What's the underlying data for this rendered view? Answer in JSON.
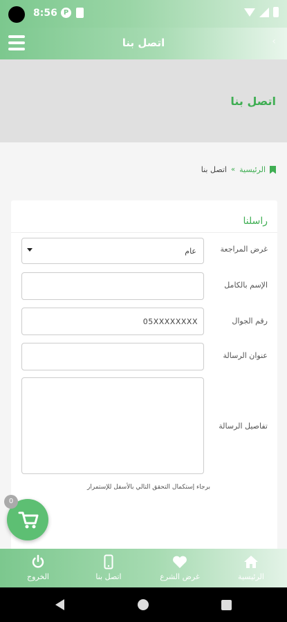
{
  "status_bar": {
    "time": "8:56"
  },
  "app_bar": {
    "title": "اتصل بنا",
    "back": "‹"
  },
  "banner": {
    "title": "اتصل بنا"
  },
  "breadcrumb": {
    "home": "الرئيسية",
    "separator": "»",
    "current": "اتصل بنا"
  },
  "form": {
    "heading": "راسلنا",
    "purpose_label": "غرض المراجعة",
    "purpose_value": "عام",
    "name_label": "الإسم بالكامل",
    "name_value": "",
    "mobile_label": "رقم الجوال",
    "mobile_value": "05XXXXXXXX",
    "subject_label": "عنوان الرسالة",
    "subject_value": "",
    "details_label": "تفاصيل الرسالة",
    "details_value": "",
    "captcha_note": "برجاء إستكمال التحقق التالي بالأسفل للإستمرار"
  },
  "cart": {
    "count": "0"
  },
  "bottom_nav": {
    "items": [
      {
        "label": "الخروج",
        "icon": "power-icon"
      },
      {
        "label": "اتصل بنا",
        "icon": "phone-icon"
      },
      {
        "label": "غرض الشرع",
        "icon": "heart-icon"
      },
      {
        "label": "الرئيسية",
        "icon": "home-icon"
      }
    ]
  },
  "colors": {
    "accent": "#3fae53",
    "bar": "#7cc88e"
  }
}
